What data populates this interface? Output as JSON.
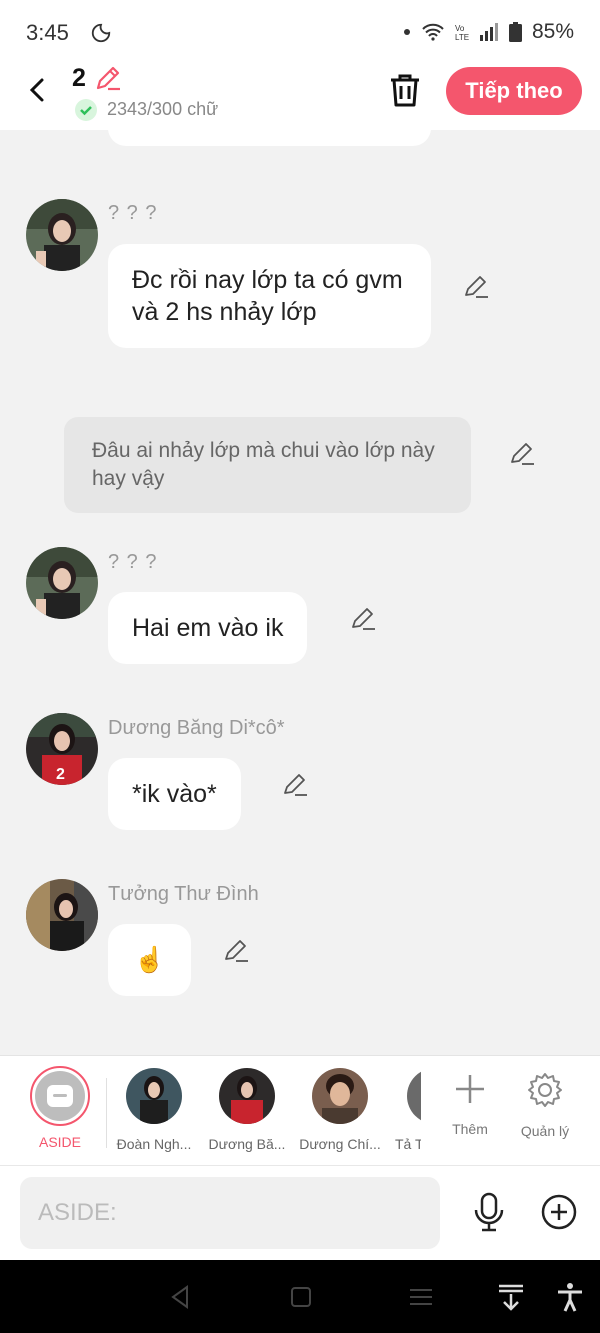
{
  "status": {
    "time": "3:45",
    "battery": "85%"
  },
  "header": {
    "count": "2",
    "word_count": "2343/300 chữ",
    "next_label": "Tiếp theo"
  },
  "messages": [
    {
      "sender": "? ? ?",
      "text": "Đc rồi nay lớp ta có gvm và 2 hs nhảy lớp"
    },
    {
      "narration": "Đâu ai nhảy lớp mà chui vào lớp này hay vậy"
    },
    {
      "sender": "? ? ?",
      "text": "Hai em vào ik"
    },
    {
      "sender": "Dương Băng Di*cô*",
      "text": "*ik vào*"
    },
    {
      "sender": "Tưởng Thư Đình",
      "text": "☝️"
    }
  ],
  "characters": [
    {
      "label": "ASIDE"
    },
    {
      "label": "Đoàn Ngh..."
    },
    {
      "label": "Dương Bă..."
    },
    {
      "label": "Dương Chí..."
    },
    {
      "label": "Tả T"
    }
  ],
  "tools": {
    "add_label": "Thêm",
    "manage_label": "Quản lý"
  },
  "input": {
    "placeholder": "ASIDE:"
  },
  "colors": {
    "accent": "#f4566d",
    "bubble": "#ffffff",
    "narration_bg": "#e6e6e6",
    "background": "#f2f2f2"
  }
}
